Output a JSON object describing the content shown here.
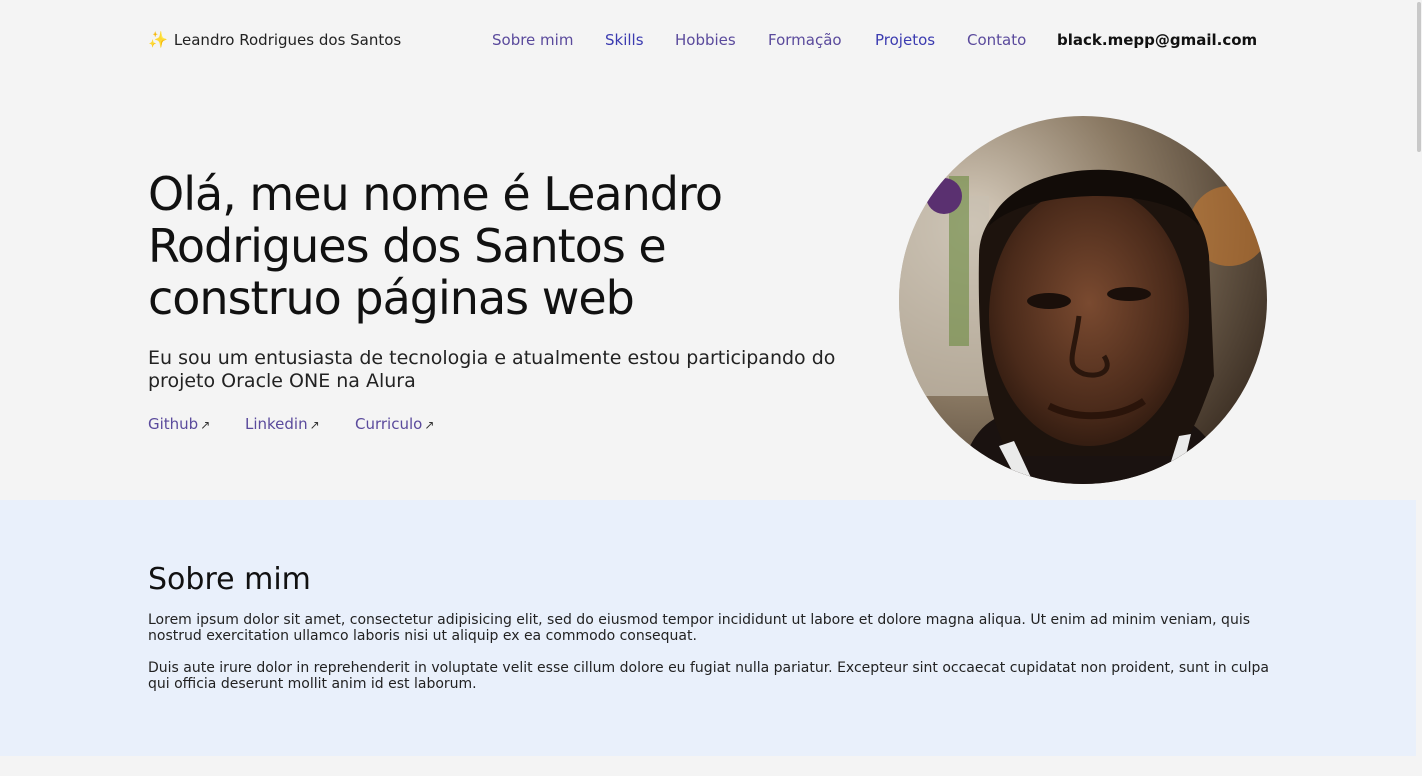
{
  "header": {
    "brand_icon": "sparkle-icon",
    "brand_glyph": "✨",
    "brand_name": "Leandro Rodrigues dos Santos",
    "nav": [
      "Sobre mim",
      "Skills",
      "Hobbies",
      "Formação",
      "Projetos",
      "Contato"
    ],
    "email": "black.mepp@gmail.com"
  },
  "hero": {
    "title": "Olá, meu nome é Leandro Rodrigues dos Santos e construo páginas web",
    "subtitle": "Eu sou um entusiasta de tecnologia e atualmente estou participando do projeto Oracle ONE na Alura",
    "links": [
      {
        "label": "Github",
        "icon": "arrow-up-right-icon",
        "glyph": "↗"
      },
      {
        "label": "Linkedin",
        "icon": "arrow-up-right-icon",
        "glyph": "↗"
      },
      {
        "label": "Curriculo",
        "icon": "arrow-up-right-icon",
        "glyph": "↗"
      }
    ]
  },
  "about": {
    "heading": "Sobre mim",
    "paragraphs": [
      "Lorem ipsum dolor sit amet, consectetur adipisicing elit, sed do eiusmod tempor incididunt ut labore et dolore magna aliqua. Ut enim ad minim veniam, quis nostrud exercitation ullamco laboris nisi ut aliquip ex ea commodo consequat.",
      "Duis aute irure dolor in reprehenderit in voluptate velit esse cillum dolore eu fugiat nulla pariatur. Excepteur sint occaecat cupidatat non proident, sunt in culpa qui officia deserunt mollit anim id est laborum."
    ]
  },
  "colors": {
    "page_bg": "#f4f4f4",
    "about_bg": "#e9f0fb",
    "nav_link": "#5a4a9c",
    "nav_link_alt": "#3b3bb0"
  }
}
